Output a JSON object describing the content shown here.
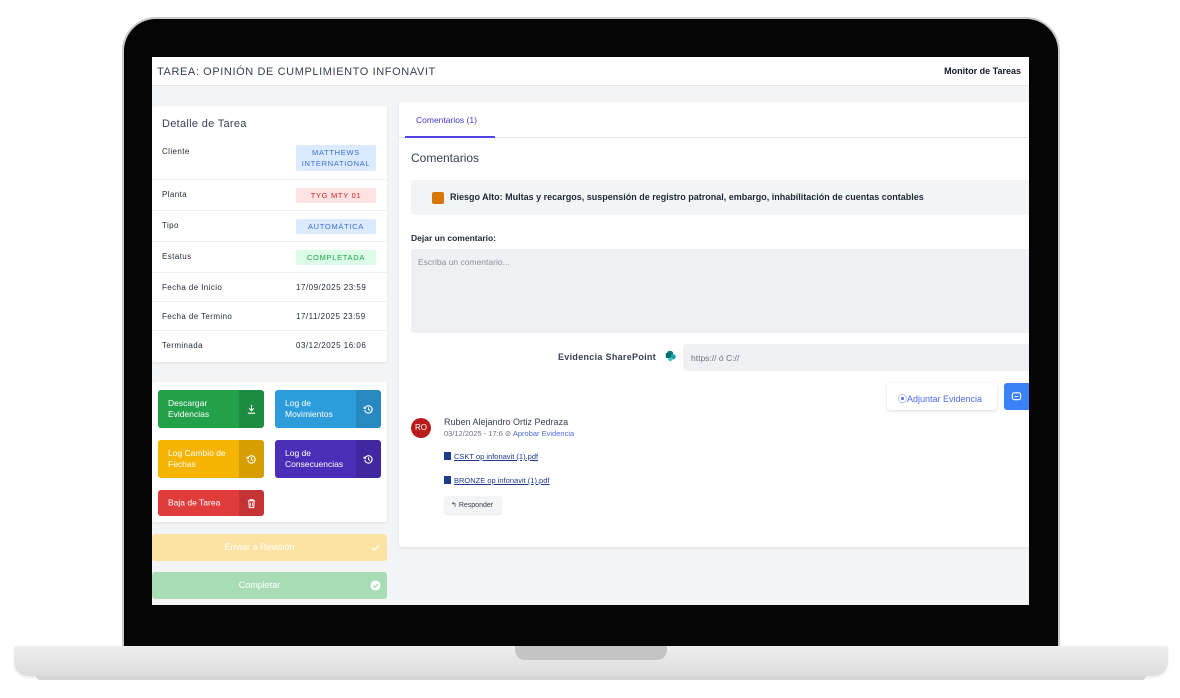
{
  "header": {
    "task_title": "TAREA: OPINIÓN DE CUMPLIMIENTO INFONAVIT",
    "monitor_link": "Monitor de Tareas"
  },
  "detail": {
    "title": "Detalle de Tarea",
    "rows": [
      {
        "label": "Cliente",
        "value": "MATTHEWS INTERNATIONAL",
        "kind": "badge",
        "color": "blue"
      },
      {
        "label": "Planta",
        "value": "TYG MTY 01",
        "kind": "badge",
        "color": "red"
      },
      {
        "label": "Tipo",
        "value": "AUTOMÁTICA",
        "kind": "badge",
        "color": "blue"
      },
      {
        "label": "Estatus",
        "value": "COMPLETADA",
        "kind": "badge",
        "color": "green"
      },
      {
        "label": "Fecha de Inicio",
        "value": "17/09/2025 23:59",
        "kind": "text"
      },
      {
        "label": "Fecha de Termino",
        "value": "17/11/2025 23:59",
        "kind": "text"
      },
      {
        "label": "Terminada",
        "value": "03/12/2025 16:06",
        "kind": "text"
      }
    ]
  },
  "actions": {
    "download_evidence": {
      "label": "Descargar Evidencias",
      "icon": "download-icon",
      "color": "#22a04a"
    },
    "movements_log": {
      "label": "Log de Movimientos",
      "icon": "history-icon",
      "color": "#2d9cdb"
    },
    "date_change_log": {
      "label": "Log Cambio de Fechas",
      "icon": "history-icon",
      "color": "#f5b400"
    },
    "consequences_log": {
      "label": "Log de Consecuencias",
      "icon": "history-icon",
      "color": "#4b2db7"
    },
    "drop_task": {
      "label": "Baja de Tarea",
      "icon": "trash-icon",
      "color": "#e03c3c"
    },
    "send_review": {
      "label": "Enviar a Revisión",
      "icon": "check-icon",
      "color": "#fce3a4"
    },
    "complete": {
      "label": "Completar",
      "icon": "check-circle-icon",
      "color": "#a8dcb5"
    }
  },
  "comments": {
    "tab_label": "Comentarios (1)",
    "section_title": "Comentarios",
    "risk_text": "Riesgo Alto: Multas y recargos, suspensión de registro patronal, embargo, inhabilitación de cuentas contables",
    "risk_color": "#d97706",
    "leave_label": "Dejar un comentario:",
    "comment_placeholder": "Escriba un comentario...",
    "sharepoint_label": "Evidencia SharePoint",
    "sharepoint_placeholder": "https:// ó C://",
    "attach_label": "Adjuntar Evidencia",
    "entry": {
      "initials": "RO",
      "author": "Ruben Alejandro Ortiz Pedraza",
      "timestamp": "03/12/2025 - 17:6",
      "approve_label": "Aprobar Evidencia",
      "files": [
        "CSKT op infonavit (1).pdf",
        "BRONZE op infonavit (1).pdf"
      ],
      "reply_label": "Responder"
    }
  }
}
